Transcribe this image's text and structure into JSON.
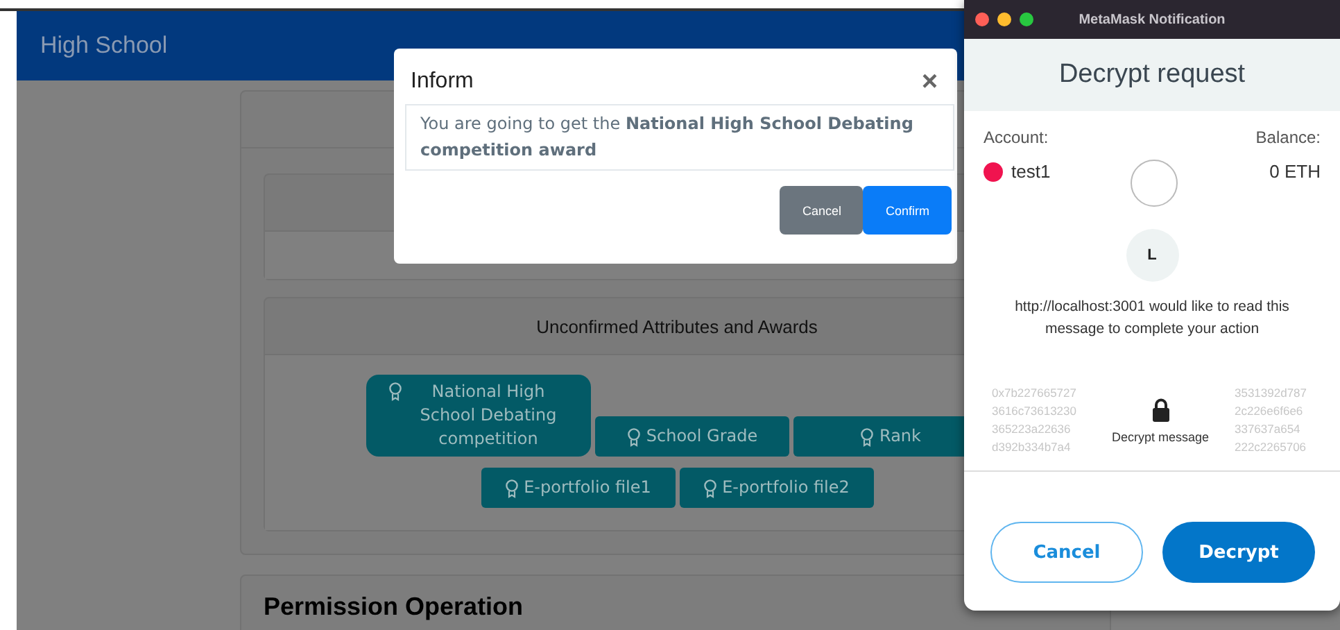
{
  "page": {
    "header_title": "High School",
    "awards_section": {
      "title": "Unconfirmed Attributes and Awards",
      "awards": [
        {
          "label": "National High School Debating competition"
        },
        {
          "label": "School Grade"
        },
        {
          "label": "Rank"
        },
        {
          "label": "E-portfolio file1"
        },
        {
          "label": "E-portfolio file2"
        }
      ]
    },
    "permission_title": "Permission Operation"
  },
  "inform_dialog": {
    "title": "Inform",
    "close": "×",
    "message": "You are going to get the **National High School Debating competition award**",
    "buttons": [
      {
        "label": "Cancel",
        "kind": "secondary"
      },
      {
        "label": "Confirm",
        "kind": "primary"
      }
    ]
  },
  "metamask": {
    "window_title": "MetaMask Notification",
    "heading": "Decrypt request",
    "account_label": "Account:",
    "account_name": "test1",
    "balance_label": "Balance:",
    "balance": "0 ETH",
    "origin_initial": "L",
    "request_text": "http://localhost:3001 would like to read this message to complete your action",
    "cipher_left": [
      "0x7b227665727",
      "3616c73613230",
      "365223a22636",
      "d392b334b7a4"
    ],
    "cipher_right": [
      "3531392d787",
      "2c226e6f6e6",
      "337637a654",
      "222c2265706"
    ],
    "decrypt_label": "Decrypt message",
    "buttons": [
      {
        "label": "Cancel",
        "kind": "secondary"
      },
      {
        "label": "Decrypt",
        "kind": "primary"
      }
    ]
  }
}
